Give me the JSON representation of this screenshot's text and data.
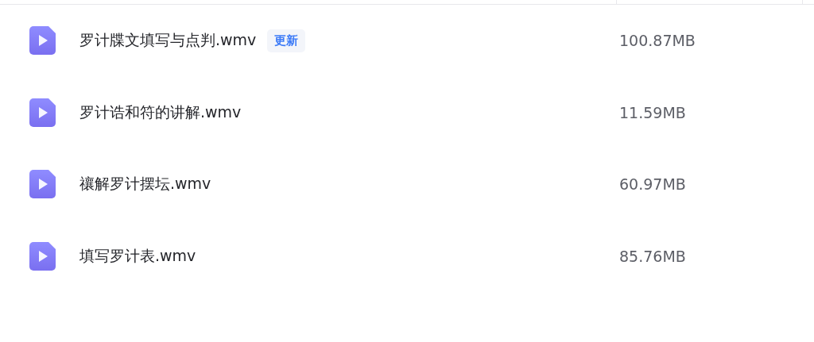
{
  "files": [
    {
      "name": "罗计牒文填写与点判.wmv",
      "badge": "更新",
      "size": "100.87MB"
    },
    {
      "name": "罗计诰和符的讲解.wmv",
      "size": "11.59MB"
    },
    {
      "name": "禳解罗计摆坛.wmv",
      "size": "60.97MB"
    },
    {
      "name": "填写罗计表.wmv",
      "size": "85.76MB"
    }
  ]
}
